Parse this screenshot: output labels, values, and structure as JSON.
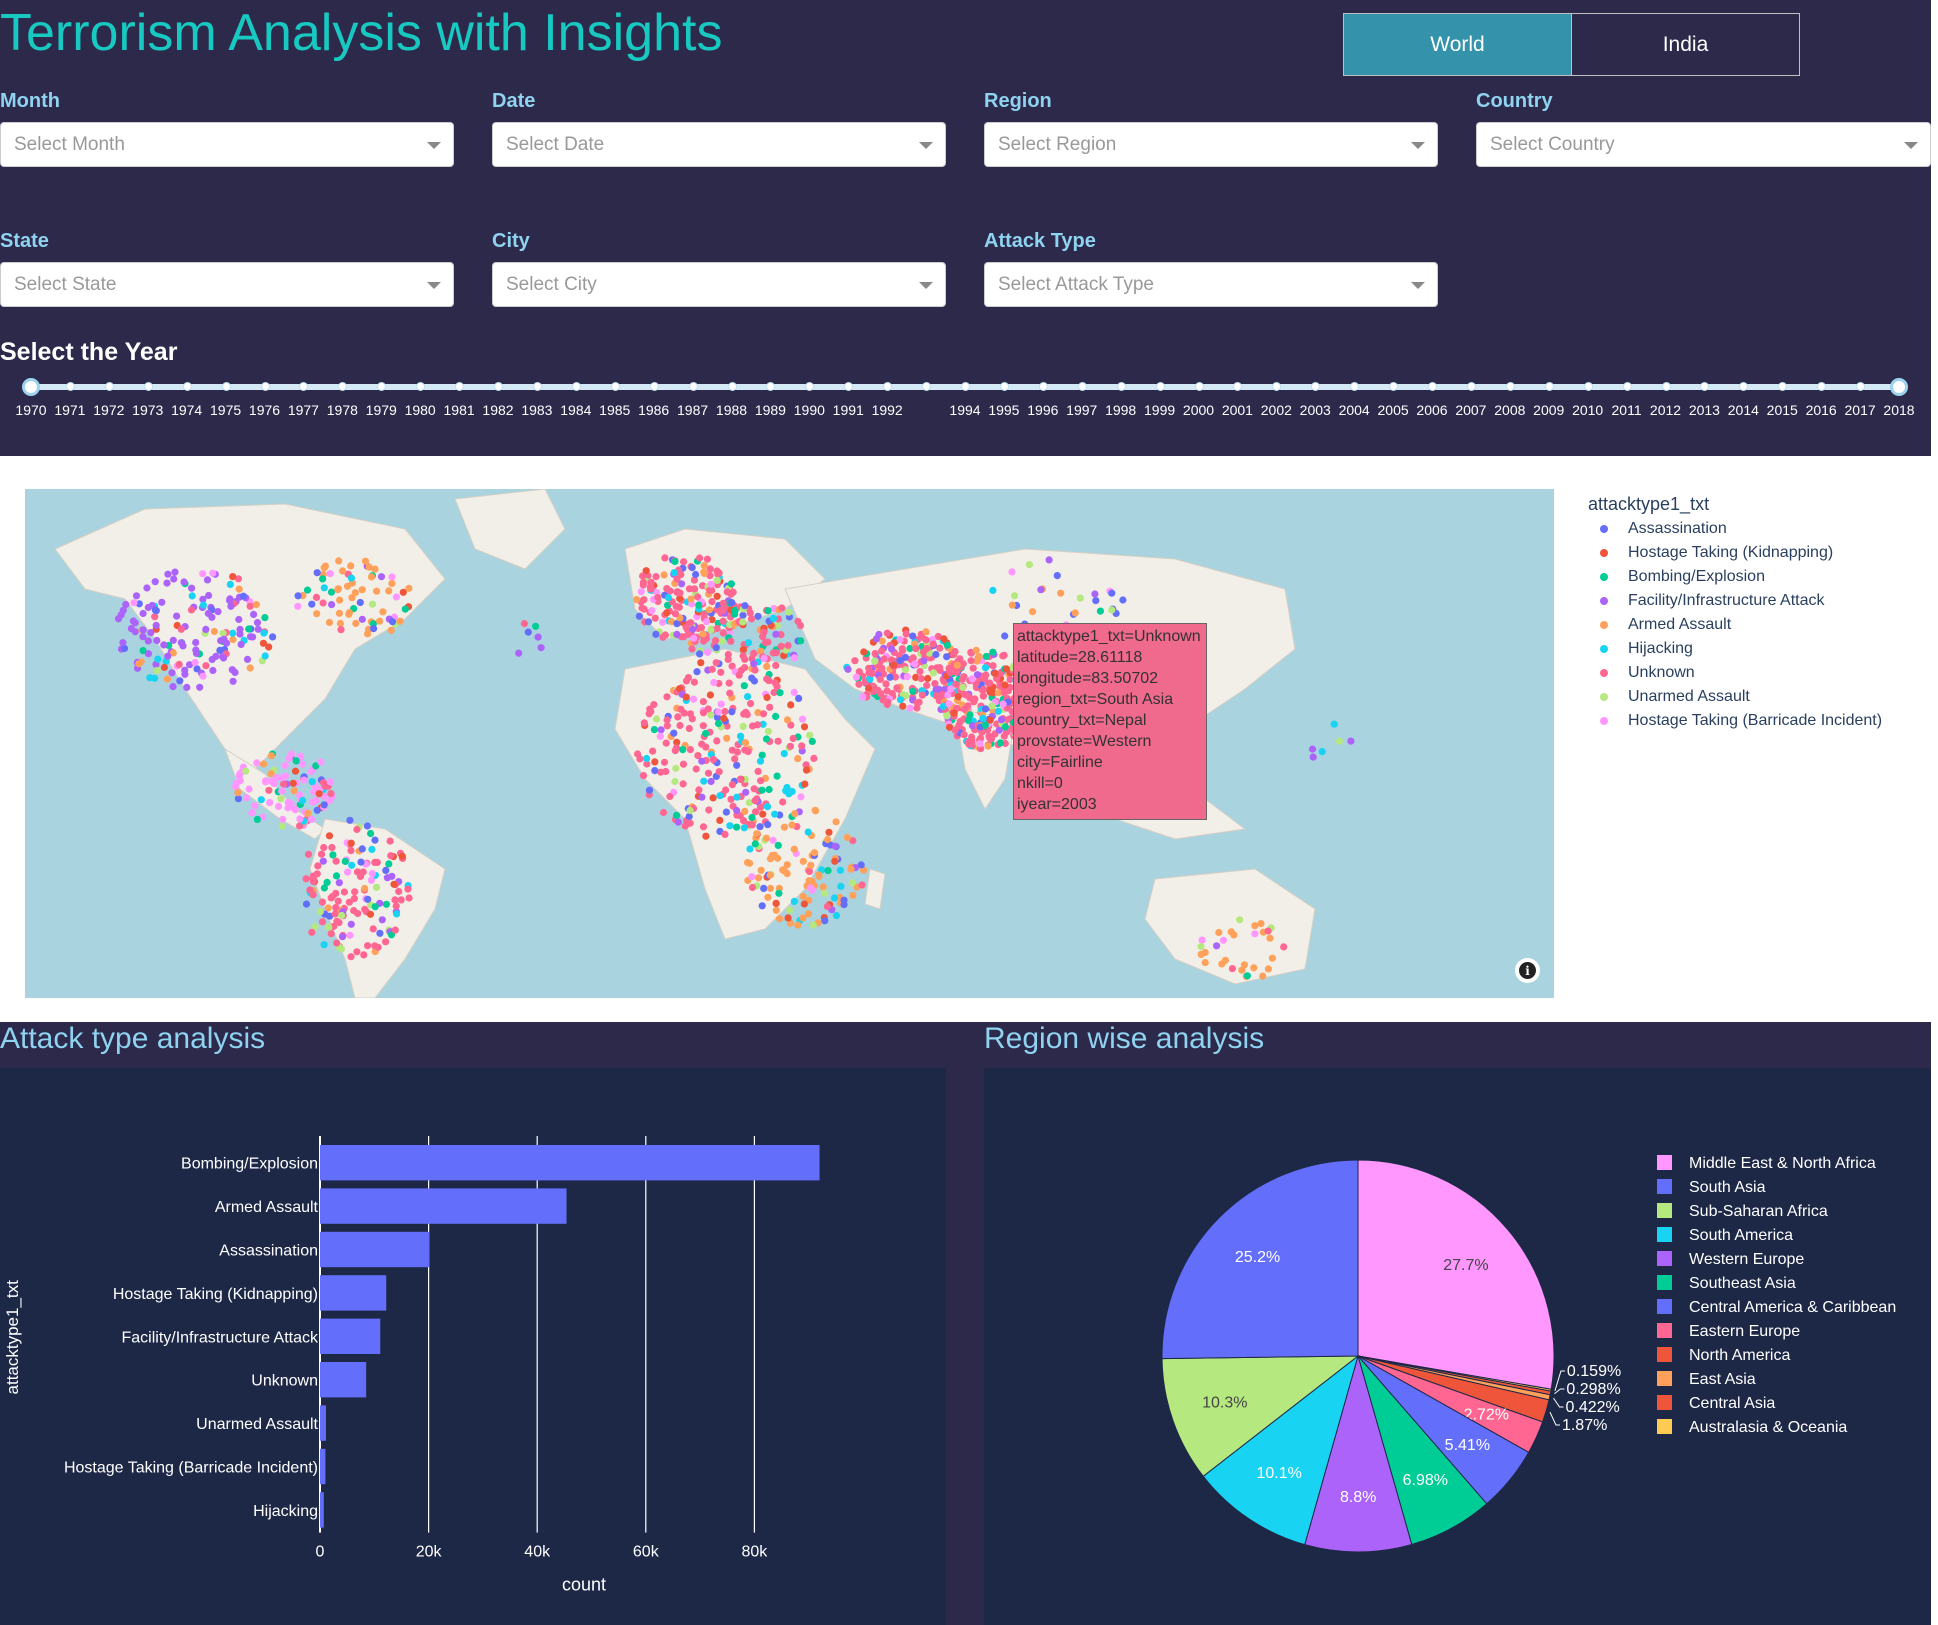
{
  "header": {
    "title": "Terrorism Analysis with Insights",
    "tabs": [
      {
        "label": "World",
        "active": true
      },
      {
        "label": "India",
        "active": false
      }
    ]
  },
  "filters": {
    "month": {
      "label": "Month",
      "placeholder": "Select Month"
    },
    "date": {
      "label": "Date",
      "placeholder": "Select Date"
    },
    "region": {
      "label": "Region",
      "placeholder": "Select Region"
    },
    "country": {
      "label": "Country",
      "placeholder": "Select Country"
    },
    "state": {
      "label": "State",
      "placeholder": "Select State"
    },
    "city": {
      "label": "City",
      "placeholder": "Select City"
    },
    "attack_type": {
      "label": "Attack Type",
      "placeholder": "Select Attack Type"
    }
  },
  "year_slider": {
    "title": "Select the Year",
    "years": [
      "1970",
      "1971",
      "1972",
      "1973",
      "1974",
      "1975",
      "1976",
      "1977",
      "1978",
      "1979",
      "1980",
      "1981",
      "1982",
      "1983",
      "1984",
      "1985",
      "1986",
      "1987",
      "1988",
      "1989",
      "1990",
      "1991",
      "1992",
      "",
      "1994",
      "1995",
      "1996",
      "1997",
      "1998",
      "1999",
      "2000",
      "2001",
      "2002",
      "2003",
      "2004",
      "2005",
      "2006",
      "2007",
      "2008",
      "2009",
      "2010",
      "2011",
      "2012",
      "2013",
      "2014",
      "2015",
      "2016",
      "2017",
      "2018"
    ],
    "range": [
      "1970",
      "2018"
    ]
  },
  "map": {
    "legend_title": "attacktype1_txt",
    "legend": [
      {
        "label": "Assassination",
        "color": "#636efa"
      },
      {
        "label": "Hostage Taking (Kidnapping)",
        "color": "#ef553b"
      },
      {
        "label": "Bombing/Explosion",
        "color": "#00cc96"
      },
      {
        "label": "Facility/Infrastructure Attack",
        "color": "#ab63fa"
      },
      {
        "label": "Armed Assault",
        "color": "#ffa15a"
      },
      {
        "label": "Hijacking",
        "color": "#19d3f3"
      },
      {
        "label": "Unknown",
        "color": "#ff6692"
      },
      {
        "label": "Unarmed Assault",
        "color": "#b6e880"
      },
      {
        "label": "Hostage Taking (Barricade Incident)",
        "color": "#ff97ff"
      }
    ],
    "hover": [
      "attacktype1_txt=Unknown",
      "latitude=28.61118",
      "longitude=83.50702",
      "region_txt=South Asia",
      "country_txt=Nepal",
      "provstate=Western",
      "city=Fairline",
      "nkill=0",
      "iyear=2003"
    ],
    "info_icon": "info-icon"
  },
  "sections": {
    "attack_title": "Attack type analysis",
    "region_title": "Region wise analysis"
  },
  "chart_data": [
    {
      "type": "bar",
      "orientation": "horizontal",
      "categories": [
        "Bombing/Explosion",
        "Armed Assault",
        "Assassination",
        "Hostage Taking (Kidnapping)",
        "Facility/Infrastructure Attack",
        "Unknown",
        "Unarmed Assault",
        "Hostage Taking (Barricade Incident)",
        "Hijacking"
      ],
      "values": [
        92000,
        45400,
        20100,
        12200,
        11100,
        8500,
        1100,
        1000,
        700
      ],
      "xlabel": "count",
      "ylabel": "attacktype1_txt",
      "xlim": [
        0,
        100000
      ],
      "xticks": [
        "0",
        "20k",
        "40k",
        "60k",
        "80k"
      ],
      "xtick_values": [
        0,
        20000,
        40000,
        60000,
        80000
      ],
      "grid": true,
      "color": "#636efa"
    },
    {
      "type": "pie",
      "labels": [
        "Middle East & North Africa",
        "South Asia",
        "Sub-Saharan Africa",
        "South America",
        "Western Europe",
        "Southeast Asia",
        "Central America & Caribbean",
        "Eastern Europe",
        "North America",
        "East Asia",
        "Central Asia",
        "Australasia & Oceania"
      ],
      "values": [
        27.7,
        25.2,
        10.3,
        10.1,
        8.8,
        6.98,
        5.41,
        2.72,
        1.87,
        0.422,
        0.298,
        0.159
      ],
      "display_labels": [
        "27.7%",
        "25.2%",
        "10.3%",
        "10.1%",
        "8.8%",
        "6.98%",
        "5.41%",
        "2.72%",
        "1.87%",
        "0.422%",
        "0.298%",
        "0.159%"
      ],
      "legend_colors": [
        "#ff97ff",
        "#636efa",
        "#b6e880",
        "#19d3f3",
        "#ab63fa",
        "#00cc96",
        "#636efa",
        "#ff6692",
        "#ef553b",
        "#ffa15a",
        "#ef553b",
        "#fecb52"
      ],
      "slice_colors_ordered": [
        "#ff97ff",
        "#fecb52",
        "#ef553b",
        "#ffa15a",
        "#ef553b",
        "#ff6692",
        "#636efa",
        "#00cc96",
        "#ab63fa",
        "#19d3f3",
        "#b6e880",
        "#636efa"
      ],
      "legend_position": "right"
    }
  ]
}
